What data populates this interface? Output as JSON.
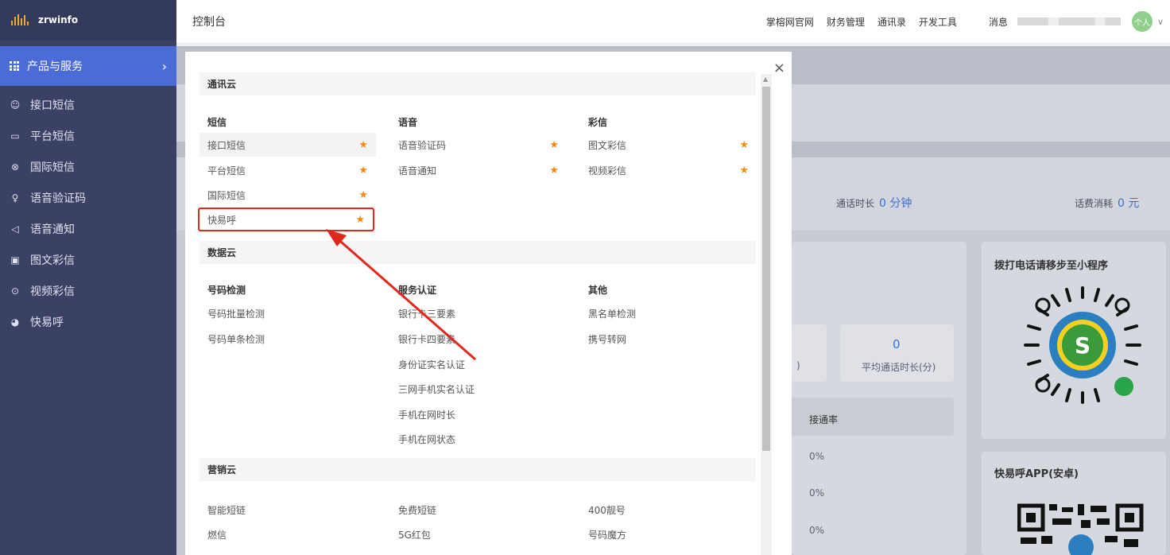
{
  "brand": {
    "name": "zrwinfo"
  },
  "sidebar": {
    "top": {
      "label": "产品与服务",
      "chevron": "›"
    },
    "items": [
      {
        "label": "接口短信",
        "icon": "☺"
      },
      {
        "label": "平台短信",
        "icon": "▭"
      },
      {
        "label": "国际短信",
        "icon": "⊗"
      },
      {
        "label": "语音验证码",
        "icon": "♀"
      },
      {
        "label": "语音通知",
        "icon": "◁"
      },
      {
        "label": "图文彩信",
        "icon": "▣"
      },
      {
        "label": "视频彩信",
        "icon": "⊙"
      },
      {
        "label": "快易呼",
        "icon": "◕"
      }
    ]
  },
  "header": {
    "title": "控制台",
    "links": [
      "掌榕网官网",
      "财务管理",
      "通讯录",
      "开发工具"
    ],
    "message": "消息",
    "avatar": "个人",
    "caret": "∨"
  },
  "background": {
    "stats": [
      {
        "label": "通话时长",
        "value": "0 分钟"
      },
      {
        "label": "话费消耗",
        "value": "0 元"
      }
    ],
    "avg_value": "0",
    "avg_label": "平均通话时长(分)",
    "partial_paren": ")",
    "table_header": "接通率",
    "rates": [
      "0%",
      "0%",
      "0%"
    ],
    "card1_title": "拨打电话请移步至小程序",
    "card2_title": "快易呼APP(安卓)"
  },
  "modal": {
    "close": "×",
    "sections": [
      {
        "title": "通讯云"
      },
      {
        "title": "数据云"
      },
      {
        "title": "营销云"
      }
    ],
    "sms": {
      "title": "短信",
      "items": [
        "接口短信",
        "平台短信",
        "国际短信",
        "快易呼"
      ]
    },
    "voice": {
      "title": "语音",
      "items": [
        "语音验证码",
        "语音通知"
      ]
    },
    "mms": {
      "title": "彩信",
      "items": [
        "图文彩信",
        "视频彩信"
      ]
    },
    "detect": {
      "title": "号码检测",
      "items": [
        "号码批量检测",
        "号码单条检测"
      ]
    },
    "auth": {
      "title": "服务认证",
      "items": [
        "银行卡三要素",
        "银行卡四要素",
        "身份证实名认证",
        "三网手机实名认证",
        "手机在网时长",
        "手机在网状态"
      ]
    },
    "other": {
      "title": "其他",
      "items": [
        "黑名单检测",
        "携号转网"
      ]
    },
    "marketing": {
      "col1": [
        "智能短链",
        "燃信"
      ],
      "col2": [
        "免费短链",
        "5G红包"
      ],
      "col3": [
        "400靓号",
        "号码魔方"
      ]
    },
    "star": "★"
  },
  "colors": {
    "sidebar": "#3b4164",
    "accent": "#4b6cd7",
    "star": "#f28b1a",
    "highlight": "#e0281c"
  }
}
